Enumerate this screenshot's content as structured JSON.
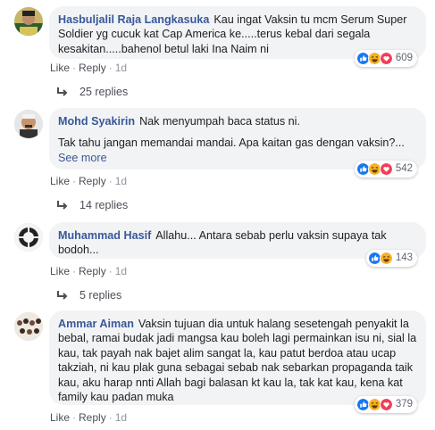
{
  "comments": [
    {
      "author": "Hasbuljalil Raja Langkasuka",
      "text": "Kau ingat Vaksin tu mcm Serum Super Soldier yg cucuk kat Cap America ke.....terus kebal dari segala kesakitan.....bahenol betul laki Ina Naim ni",
      "see_more": "",
      "reaction_count": "609",
      "like": "Like",
      "reply": "Reply",
      "time": "1d",
      "replies": "25 replies"
    },
    {
      "author": "Mohd Syakirin",
      "text": "Nak menyumpah baca status ni.",
      "text2": "Tak tahu jangan memandai mandai. Apa kaitan gas dengan vaksin?...",
      "see_more": "See more",
      "reaction_count": "542",
      "like": "Like",
      "reply": "Reply",
      "time": "1d",
      "replies": "14 replies"
    },
    {
      "author": "Muhammad Hasif",
      "text": "Allahu... Antara sebab perlu vaksin supaya tak bodoh...",
      "see_more": "",
      "reaction_count": "143",
      "like": "Like",
      "reply": "Reply",
      "time": "1d",
      "replies": "5 replies"
    },
    {
      "author": "Ammar Aiman",
      "text": "Vaksin tujuan dia untuk halang sesetengah penyakit la bebal, ramai budak jadi mangsa kau boleh lagi permainkan isu ni, sial la kau, tak payah nak bajet alim sangat la, kau patut berdoa atau ucap takziah, ni kau plak guna sebagai sebab nak sebarkan propaganda taik kau, aku harap nnti Allah bagi balasan kt kau la, tak kat kau, kena kat family kau padan muka",
      "see_more": "",
      "reaction_count": "379",
      "like": "Like",
      "reply": "Reply",
      "time": "1d",
      "replies": ""
    }
  ],
  "colors": {
    "like": "#1877f2",
    "love": "#f33e58",
    "haha": "#f7b125",
    "author": "#385898"
  },
  "icons": [
    "like-reaction-icon",
    "haha-reaction-icon",
    "love-reaction-icon",
    "reply-arrow-icon"
  ]
}
